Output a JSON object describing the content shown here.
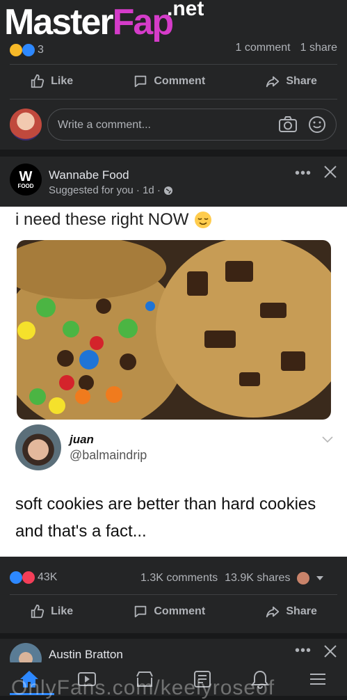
{
  "watermark": {
    "logo_main": "Master",
    "logo_accent": "Fap",
    "logo_suffix": ".net",
    "footer": "OnlyFans.com/keelyroseof"
  },
  "prev_post": {
    "reaction_count": "3",
    "comments": "1 comment",
    "shares": "1 share",
    "like_label": "Like",
    "comment_label": "Comment",
    "share_label": "Share",
    "comment_placeholder": "Write a comment..."
  },
  "post": {
    "page_name": "Wannabe Food",
    "page_logo_text": "FOOD",
    "subtitle": "Suggested for you · 1d ·",
    "caption": "i need these right NOW",
    "tweet": {
      "name": "juan",
      "handle": "@balmaindrip",
      "text": "soft cookies are better than hard cookies and that's a fact..."
    },
    "reactions": "43K",
    "comments": "1.3K comments",
    "shares": "13.9K shares",
    "like_label": "Like",
    "comment_label": "Comment",
    "share_label": "Share"
  },
  "next_post": {
    "author": "Austin Bratton"
  },
  "colors": {
    "accent": "#2d88ff",
    "bg": "#18191a",
    "card": "#242526"
  }
}
